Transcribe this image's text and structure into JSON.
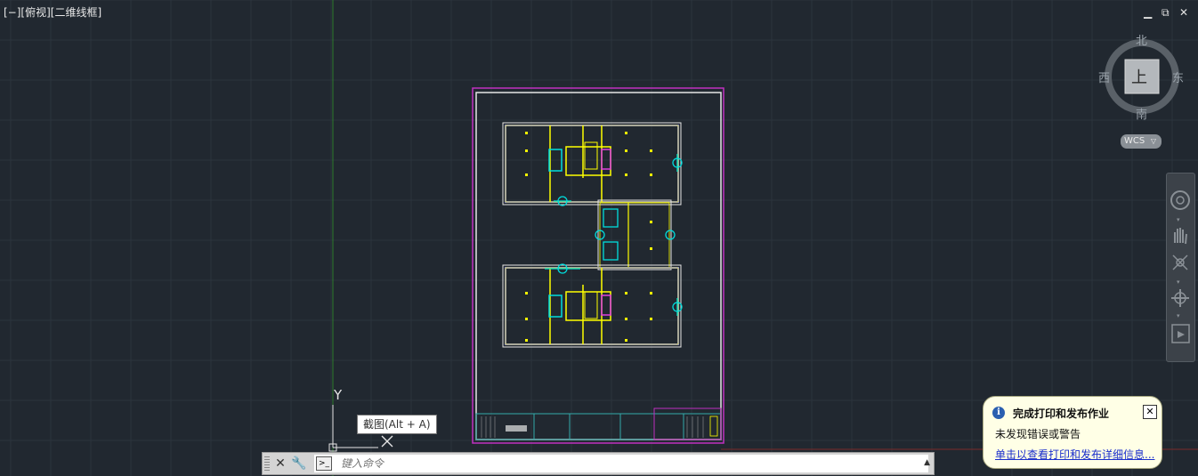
{
  "viewport": {
    "label": "[−][俯视][二维线框]",
    "controls": {
      "minimize": "▁",
      "restore": "⧉",
      "close": "✕"
    }
  },
  "viewcube": {
    "north": "北",
    "south": "南",
    "east": "东",
    "west": "西",
    "face": "上",
    "wcs": "WCS"
  },
  "ucs": {
    "y_label": "Y",
    "x_label": "X"
  },
  "tooltip": {
    "text": "截图(Alt + A)"
  },
  "command_line": {
    "placeholder": "键入命令",
    "close_icon": "close-icon",
    "customize_icon": "wrench-icon",
    "prompt_icon": "command-prompt-icon"
  },
  "notification": {
    "title": "完成打印和发布作业",
    "message": "未发现错误或警告",
    "link": "单击以查看打印和发布详细信息..."
  },
  "colors": {
    "background": "#212830",
    "grid": "#2c343d",
    "sheet_border": "#c030c0",
    "wall": "#ffff00",
    "accent_cyan": "#00d0d0",
    "accent_magenta": "#e040e0"
  }
}
